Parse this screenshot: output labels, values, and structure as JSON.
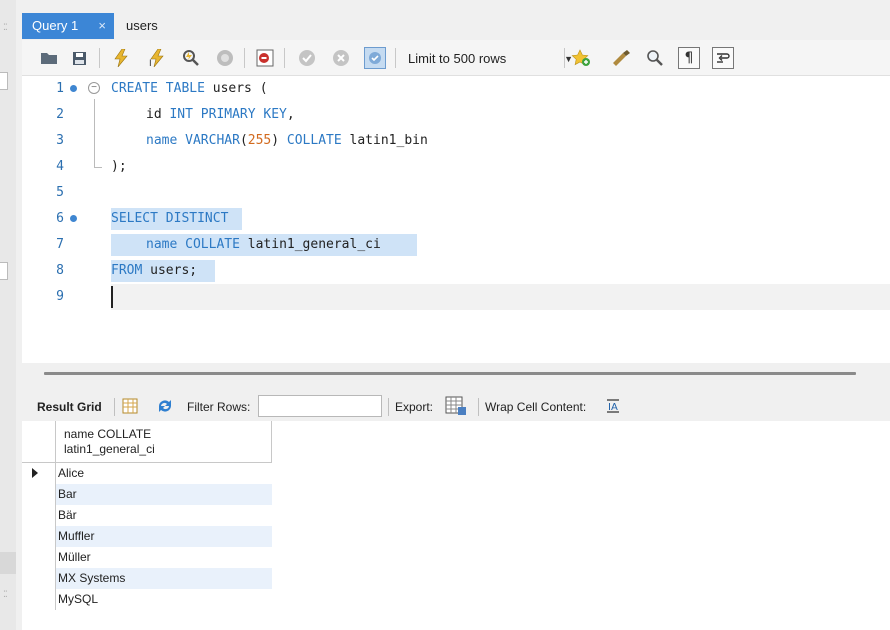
{
  "tabs": [
    {
      "label": "Query 1",
      "active": true,
      "close": "×"
    },
    {
      "label": "users",
      "active": false
    }
  ],
  "toolbar": {
    "icons": [
      "open-folder-icon",
      "save-icon",
      "execute-icon",
      "execute-current-icon",
      "explain-icon",
      "stop-icon",
      "toggle-error-icon",
      "commit-icon",
      "rollback-icon",
      "autocommit-icon",
      "favorite-icon",
      "beautify-icon",
      "find-icon",
      "invisibles-icon",
      "wrap-icon"
    ],
    "limit_label": "Limit to 500 rows"
  },
  "editor": {
    "lines": [
      {
        "n": "1"
      },
      {
        "n": "2"
      },
      {
        "n": "3"
      },
      {
        "n": "4"
      },
      {
        "n": "5"
      },
      {
        "n": "6"
      },
      {
        "n": "7"
      },
      {
        "n": "8"
      },
      {
        "n": "9"
      }
    ],
    "code": {
      "l1_kw": "CREATE TABLE",
      "l1_rest": " users (",
      "l2_id": "id ",
      "l2_kw": "INT PRIMARY KEY",
      "l2_rest": ",",
      "l3_name": "name ",
      "l3_kw": "VARCHAR",
      "l3_open": "(",
      "l3_num": "255",
      "l3_close": ") ",
      "l3_kw2": "COLLATE",
      "l3_rest": " latin1_bin",
      "l4": ");",
      "l6_kw": "SELECT DISTINCT",
      "l7_name": "name ",
      "l7_kw": "COLLATE",
      "l7_rest": " latin1_general_ci",
      "l8_kw": "FROM",
      "l8_rest": " users;"
    }
  },
  "results": {
    "tab_label": "Result Grid",
    "filter_label": "Filter Rows:",
    "filter_value": "",
    "export_label": "Export:",
    "wrap_label": "Wrap Cell Content:",
    "column_line1": "name COLLATE",
    "column_line2": "latin1_general_ci",
    "rows": [
      "Alice",
      "Bar",
      "Bär",
      "Muffler",
      "Müller",
      "MX Systems",
      "MySQL"
    ]
  },
  "colors": {
    "tab_active": "#3c86d6",
    "keyword": "#2c79c4",
    "number": "#d26a1e",
    "selection": "#cfe3f7",
    "row_alt": "#e9f1fb"
  }
}
